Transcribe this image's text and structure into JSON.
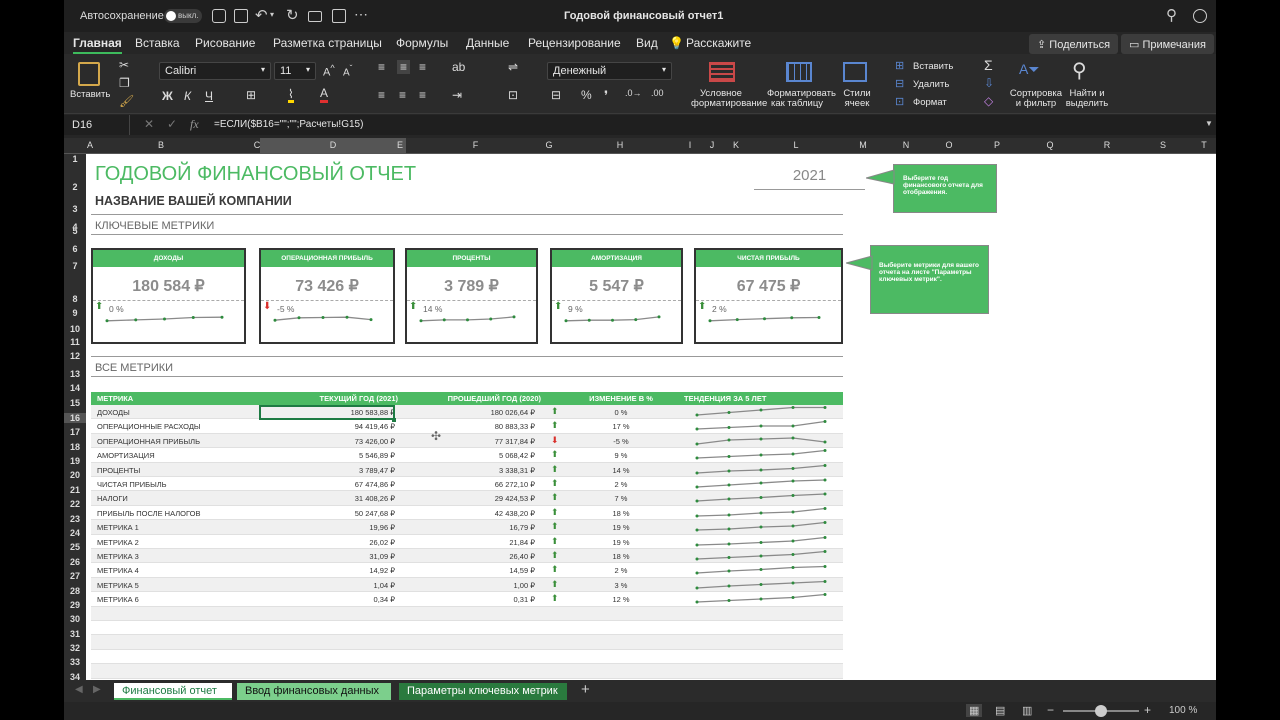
{
  "window": {
    "autosave_label": "Автосохранение",
    "autosave_state": "выкл.",
    "title": "Годовой финансовый отчет1"
  },
  "tabs": [
    "Главная",
    "Вставка",
    "Рисование",
    "Разметка страницы",
    "Формулы",
    "Данные",
    "Рецензирование",
    "Вид",
    "Расскажите"
  ],
  "header_buttons": {
    "share": "Поделиться",
    "comments": "Примечания"
  },
  "ribbon": {
    "paste": "Вставить",
    "font_name": "Calibri",
    "font_size": "11",
    "bold": "Ж",
    "italic": "К",
    "underline": "Ч",
    "number_format": "Денежный",
    "percent": "%",
    "conditional_format": "Условное форматирование",
    "format_table": "Форматировать как таблицу",
    "cell_styles": "Стили ячеек",
    "insert": "Вставить",
    "delete": "Удалить",
    "format": "Формат",
    "sort_filter": "Сортировка и фильтр",
    "find_select": "Найти и выделить"
  },
  "formula_bar": {
    "cell_ref": "D16",
    "fx": "fx",
    "formula": "=ЕСЛИ($B16=\"\";\"\";Расчеты!G15)"
  },
  "columns": [
    "A",
    "B",
    "C",
    "D",
    "E",
    "F",
    "G",
    "H",
    "I",
    "J",
    "K",
    "L",
    "M",
    "N",
    "O",
    "P",
    "Q",
    "R",
    "S",
    "T"
  ],
  "rows": [
    "1",
    "2",
    "3",
    "4",
    "5",
    "6",
    "7",
    "8",
    "9",
    "10",
    "11",
    "12",
    "13",
    "14",
    "15",
    "16",
    "17",
    "18",
    "19",
    "20",
    "21",
    "22",
    "23",
    "24",
    "25",
    "26",
    "27",
    "28",
    "29",
    "30",
    "31",
    "32",
    "33",
    "34"
  ],
  "report": {
    "title": "ГОДОВОЙ ФИНАНСОВЫЙ ОТЧЕТ",
    "company": "НАЗВАНИЕ ВАШЕЙ КОМПАНИИ",
    "year": "2021",
    "key_metrics_heading": "КЛЮЧЕВЫЕ МЕТРИКИ",
    "all_metrics_heading": "ВСЕ МЕТРИКИ",
    "note_year": "Выберите год финансового отчета для отображения.",
    "note_metrics": "Выберите метрики для вашего отчета на листе \"Параметры ключевых метрик\"."
  },
  "cards": [
    {
      "title": "ДОХОДЫ",
      "value": "180 584 ₽",
      "change": "0 %",
      "dir": "up",
      "trend": [
        0.2,
        0.35,
        0.5,
        0.75,
        0.8
      ]
    },
    {
      "title": "ОПЕРАЦИОННАЯ ПРИБЫЛЬ",
      "value": "73 426 ₽",
      "change": "-5 %",
      "dir": "down",
      "trend": [
        0.3,
        0.7,
        0.75,
        0.8,
        0.4
      ]
    },
    {
      "title": "ПРОЦЕНТЫ",
      "value": "3 789 ₽",
      "change": "14 %",
      "dir": "up",
      "trend": [
        0.2,
        0.35,
        0.35,
        0.5,
        0.85
      ]
    },
    {
      "title": "АМОРТИЗАЦИЯ",
      "value": "5 547 ₽",
      "change": "9 %",
      "dir": "up",
      "trend": [
        0.2,
        0.3,
        0.3,
        0.4,
        0.85
      ]
    },
    {
      "title": "ЧИСТАЯ ПРИБЫЛЬ",
      "value": "67 475 ₽",
      "change": "2 %",
      "dir": "up",
      "trend": [
        0.2,
        0.4,
        0.55,
        0.7,
        0.75
      ]
    }
  ],
  "table": {
    "headers": [
      "МЕТРИКА",
      "ТЕКУЩИЙ ГОД (2021)",
      "ПРОШЕДШИЙ ГОД (2020)",
      "ИЗМЕНЕНИЕ В %",
      "ТЕНДЕНЦИЯ ЗА 5 ЛЕТ"
    ],
    "rows": [
      {
        "name": "ДОХОДЫ",
        "cur": "180 583,88 ₽",
        "prev": "180 026,64 ₽",
        "dir": "up",
        "pct": "0 %",
        "trend": [
          0.2,
          0.45,
          0.7,
          0.95,
          0.95
        ]
      },
      {
        "name": "ОПЕРАЦИОННЫЕ РАСХОДЫ",
        "cur": "94 419,46 ₽",
        "prev": "80 883,33 ₽",
        "dir": "up",
        "pct": "17 %",
        "trend": [
          0.2,
          0.35,
          0.5,
          0.5,
          0.95
        ]
      },
      {
        "name": "ОПЕРАЦИОННАЯ ПРИБЫЛЬ",
        "cur": "73 426,00 ₽",
        "prev": "77 317,84 ₽",
        "dir": "down",
        "pct": "-5 %",
        "trend": [
          0.2,
          0.6,
          0.7,
          0.8,
          0.4
        ]
      },
      {
        "name": "АМОРТИЗАЦИЯ",
        "cur": "5 546,89 ₽",
        "prev": "5 068,42 ₽",
        "dir": "up",
        "pct": "9 %",
        "trend": [
          0.2,
          0.35,
          0.5,
          0.6,
          0.95
        ]
      },
      {
        "name": "ПРОЦЕНТЫ",
        "cur": "3 789,47 ₽",
        "prev": "3 338,31 ₽",
        "dir": "up",
        "pct": "14 %",
        "trend": [
          0.2,
          0.4,
          0.5,
          0.65,
          0.95
        ]
      },
      {
        "name": "ЧИСТАЯ ПРИБЫЛЬ",
        "cur": "67 474,86 ₽",
        "prev": "66 272,10 ₽",
        "dir": "up",
        "pct": "2 %",
        "trend": [
          0.2,
          0.4,
          0.6,
          0.8,
          0.9
        ]
      },
      {
        "name": "НАЛОГИ",
        "cur": "31 408,26 ₽",
        "prev": "29 424,53 ₽",
        "dir": "up",
        "pct": "7 %",
        "trend": [
          0.2,
          0.4,
          0.55,
          0.75,
          0.9
        ]
      },
      {
        "name": "ПРИБЫЛЬ ПОСЛЕ НАЛОГОВ",
        "cur": "50 247,68 ₽",
        "prev": "42 438,20 ₽",
        "dir": "up",
        "pct": "18 %",
        "trend": [
          0.2,
          0.3,
          0.5,
          0.6,
          0.95
        ]
      },
      {
        "name": "МЕТРИКА 1",
        "cur": "19,96 ₽",
        "prev": "16,79 ₽",
        "dir": "up",
        "pct": "19 %",
        "trend": [
          0.2,
          0.3,
          0.5,
          0.6,
          0.95
        ]
      },
      {
        "name": "МЕТРИКА 2",
        "cur": "26,02 ₽",
        "prev": "21,84 ₽",
        "dir": "up",
        "pct": "19 %",
        "trend": [
          0.2,
          0.3,
          0.45,
          0.6,
          0.95
        ]
      },
      {
        "name": "МЕТРИКА 3",
        "cur": "31,09 ₽",
        "prev": "26,40 ₽",
        "dir": "up",
        "pct": "18 %",
        "trend": [
          0.2,
          0.35,
          0.5,
          0.65,
          0.95
        ]
      },
      {
        "name": "МЕТРИКА 4",
        "cur": "14,92 ₽",
        "prev": "14,59 ₽",
        "dir": "up",
        "pct": "2 %",
        "trend": [
          0.2,
          0.4,
          0.55,
          0.75,
          0.85
        ]
      },
      {
        "name": "МЕТРИКА 5",
        "cur": "1,04 ₽",
        "prev": "1,00 ₽",
        "dir": "up",
        "pct": "3 %",
        "trend": [
          0.2,
          0.4,
          0.55,
          0.7,
          0.85
        ]
      },
      {
        "name": "МЕТРИКА 6",
        "cur": "0,34 ₽",
        "prev": "0,31 ₽",
        "dir": "up",
        "pct": "12 %",
        "trend": [
          0.2,
          0.35,
          0.5,
          0.65,
          0.95
        ]
      }
    ]
  },
  "sheet_tabs": [
    "Финансовый отчет",
    "Ввод финансовых данных",
    "Параметры ключевых метрик"
  ],
  "add_sheet": "+",
  "zoom": "100 %",
  "colors": {
    "accent": "#4cba63",
    "up": "#3a8f3a",
    "down": "#d9302c",
    "chrome": "#262626"
  }
}
